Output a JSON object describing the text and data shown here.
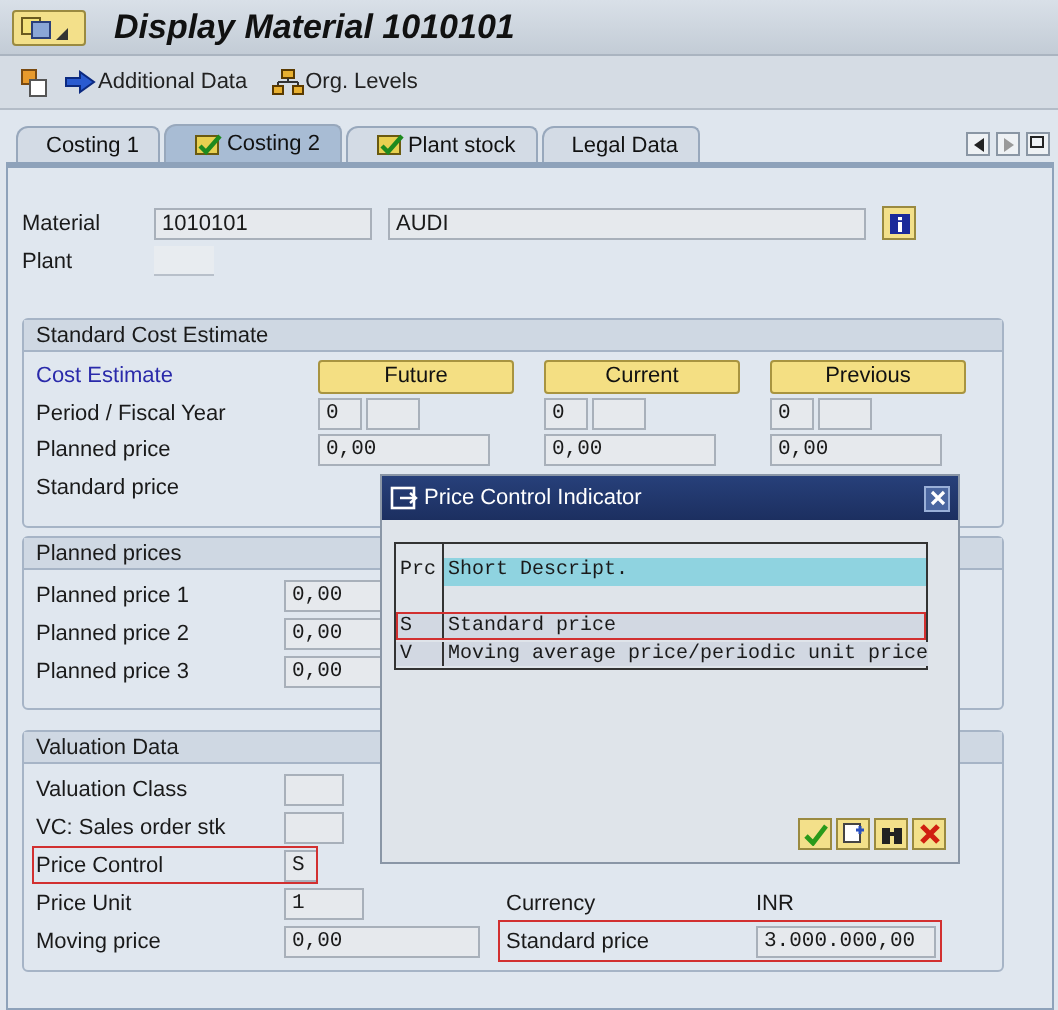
{
  "window": {
    "title": "Display Material 1010101"
  },
  "toolbar": [
    {
      "label": "Additional Data",
      "kind": "arrow"
    },
    {
      "label": "Org. Levels",
      "kind": "hierarchy"
    }
  ],
  "tabs": [
    {
      "label": "Costing 1",
      "selected": false,
      "maintained": false
    },
    {
      "label": "Costing 2",
      "selected": true,
      "maintained": true
    },
    {
      "label": "Plant stock",
      "selected": false,
      "maintained": true
    },
    {
      "label": "Legal Data",
      "selected": false,
      "maintained": false
    }
  ],
  "header": {
    "material_label": "Material",
    "material": "1010101",
    "description": "AUDI",
    "plant_label": "Plant"
  },
  "standard_cost_estimate": {
    "title": "Standard Cost Estimate",
    "cost_estimate_label": "Cost Estimate",
    "period_label": "Period / Fiscal Year",
    "planned_label": "Planned price",
    "standard_label": "Standard price",
    "columns": [
      {
        "button": "Future",
        "period": "0",
        "planned_price": "0,00"
      },
      {
        "button": "Current",
        "period": "0",
        "planned_price": "0,00"
      },
      {
        "button": "Previous",
        "period": "0",
        "planned_price": "0,00"
      }
    ]
  },
  "planned_prices": {
    "title": "Planned prices",
    "rows": [
      {
        "label": "Planned price 1",
        "value": "0,00"
      },
      {
        "label": "Planned price 2",
        "value": "0,00"
      },
      {
        "label": "Planned price 3",
        "value": "0,00"
      }
    ]
  },
  "valuation_data": {
    "title": "Valuation Data",
    "rows": [
      {
        "label": "Valuation Class"
      },
      {
        "label": "VC: Sales order stk"
      },
      {
        "label": "Price Control",
        "value": "S",
        "highlighted": true
      },
      {
        "label": "Price Unit",
        "value": "1"
      },
      {
        "label": "Moving price",
        "value": "0,00"
      }
    ],
    "currency_label": "Currency",
    "currency": "INR",
    "standard_price_label": "Standard price",
    "standard_price": "3.000.000,00",
    "standard_price_highlighted": true
  },
  "dialog": {
    "title": "Price Control Indicator",
    "columns": [
      "Prc",
      "Short Descript."
    ],
    "rows": [
      {
        "code": "S",
        "text": "Standard price",
        "selected": true
      },
      {
        "code": "V",
        "text": "Moving average price/periodic unit price",
        "selected": false
      }
    ]
  }
}
